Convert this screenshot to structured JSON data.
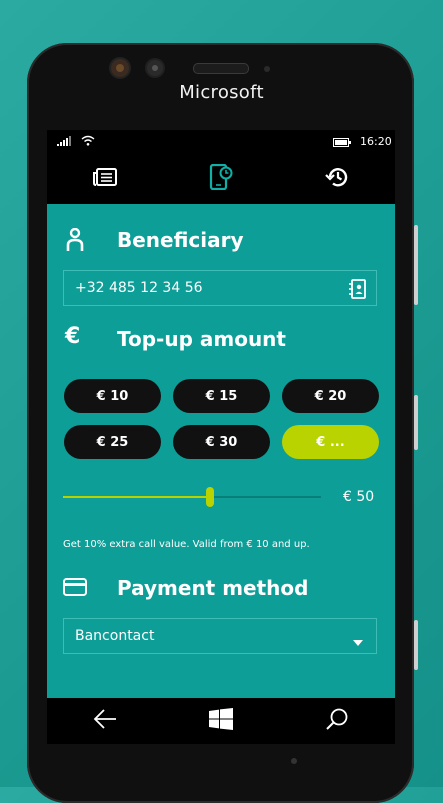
{
  "device": {
    "brand": "Microsoft"
  },
  "status_bar": {
    "time": "16:20"
  },
  "tabs": [
    {
      "icon": "news-icon",
      "active": false
    },
    {
      "icon": "phone-topup-icon",
      "active": true
    },
    {
      "icon": "history-icon",
      "active": false
    }
  ],
  "beneficiary": {
    "title": "Beneficiary",
    "phone_value": "+32 485 12 34 56"
  },
  "topup": {
    "title": "Top-up amount",
    "currency_symbol": "€",
    "amounts": [
      "€ 10",
      "€ 15",
      "€ 20",
      "€ 25",
      "€ 30",
      "€ ..."
    ],
    "selected_index": 5,
    "slider_value_label": "€ 50",
    "slider_fraction": 0.57,
    "promo_text": "Get 10% extra call value. Valid from € 10 and up."
  },
  "payment": {
    "title": "Payment method",
    "selected": "Bancontact"
  },
  "colors": {
    "accent": "#b9d300",
    "panel": "#0e9e98",
    "pill": "#111111"
  }
}
